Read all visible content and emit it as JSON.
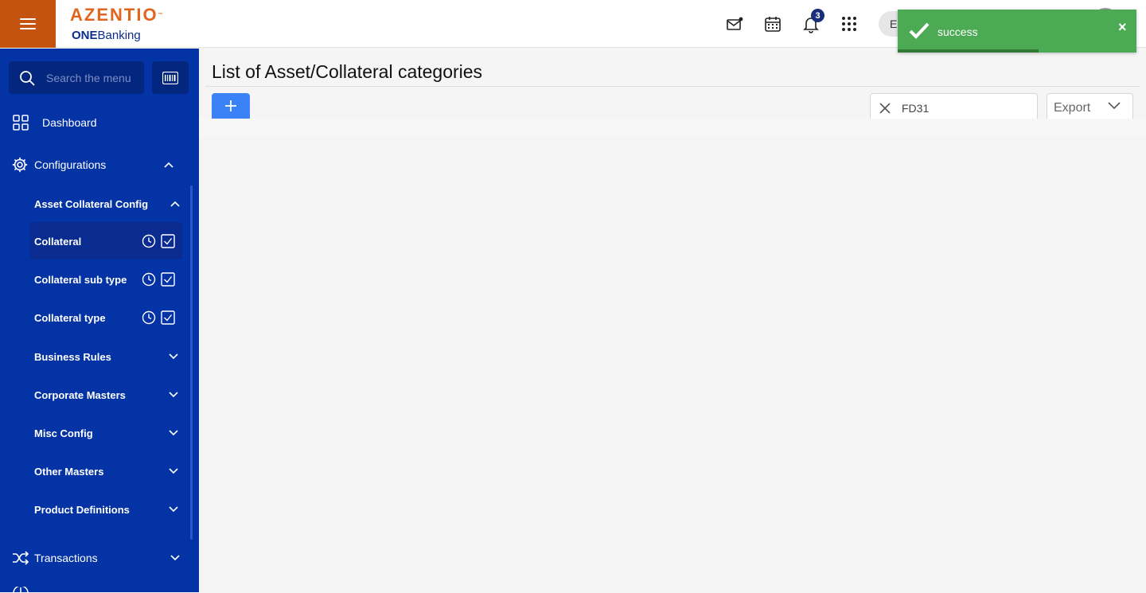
{
  "header": {
    "brand_main": "AZENTIO",
    "brand_tm": "™",
    "brand_sub_bold": "ONE",
    "brand_sub_rest": "Banking",
    "notification_count": "3",
    "lang_initial": "E",
    "icons": [
      "menu-icon",
      "mail-icon",
      "calendar-icon",
      "bell-icon",
      "apps-grid-icon"
    ]
  },
  "sidebar": {
    "search_placeholder": "Search the menu",
    "items": [
      {
        "label": "Dashboard",
        "icon": "dashboard-grid-icon"
      },
      {
        "label": "Configurations",
        "icon": "gear-icon",
        "expanded": true
      },
      {
        "label": "Asset Collateral Config",
        "expanded": true
      },
      {
        "label": "Collateral",
        "selected": true
      },
      {
        "label": "Collateral sub type"
      },
      {
        "label": "Collateral type"
      },
      {
        "label": "Business Rules"
      },
      {
        "label": "Corporate Masters"
      },
      {
        "label": "Misc Config"
      },
      {
        "label": "Other Masters"
      },
      {
        "label": "Product Definitions"
      },
      {
        "label": "Transactions",
        "icon": "shuffle-icon"
      }
    ]
  },
  "main": {
    "title": "List of Asset/Collateral categories",
    "filter_value": "FD31",
    "export_label": "Export"
  },
  "toast": {
    "message": "success",
    "close_glyph": "×",
    "progress": 0.59
  },
  "colors": {
    "sidebar_bg": "#0433a6",
    "accent_orange": "#c4530f",
    "toast_green": "#4caa55",
    "add_button_blue": "#3b82f6"
  }
}
